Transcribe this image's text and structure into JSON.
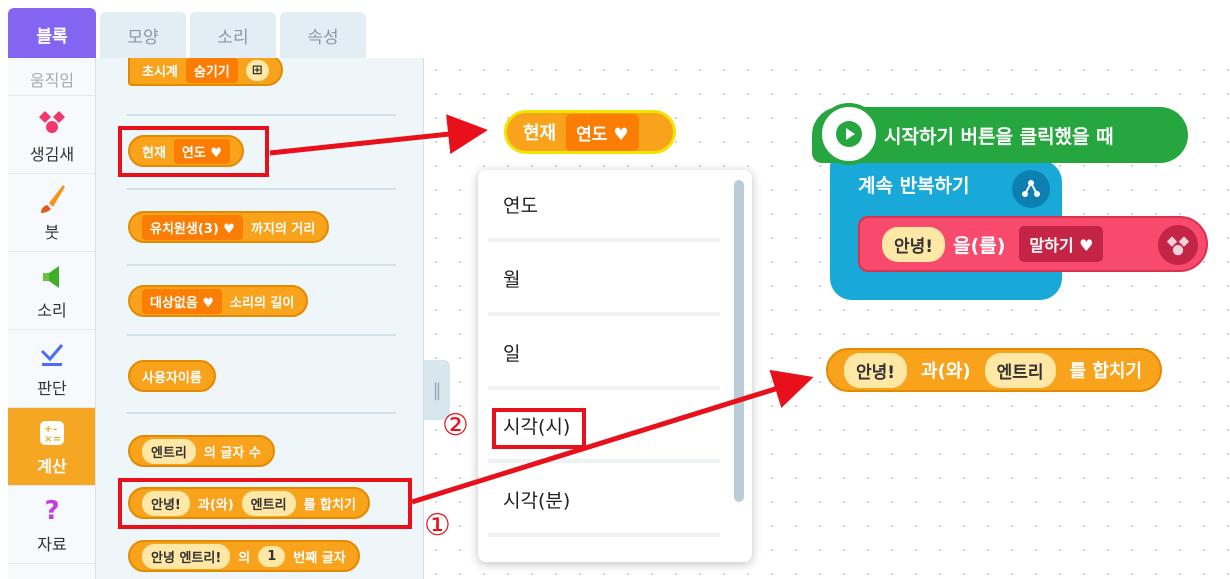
{
  "tabs": [
    "블록",
    "모양",
    "소리",
    "속성"
  ],
  "categories": [
    "움직임",
    "생김새",
    "붓",
    "소리",
    "판단",
    "계산",
    "자료"
  ],
  "palette": {
    "timer": {
      "label": "초시계",
      "dropdown": "숨기기"
    },
    "current": {
      "label": "현재",
      "dropdown": "연도"
    },
    "distance": {
      "dropdown": "유치원생(3)",
      "label": "까지의 거리"
    },
    "sound_len": {
      "dropdown": "대상없음",
      "label": "소리의 길이"
    },
    "username": "사용자이름",
    "length": {
      "value": "엔트리",
      "label": "의 글자 수"
    },
    "join": {
      "a": "안녕!",
      "mid": "과(와)",
      "b": "엔트리",
      "end": "를 합치기"
    },
    "nth": {
      "a": "안녕 엔트리!",
      "mid": "의",
      "n": "1",
      "end": "번째 글자"
    }
  },
  "workspace": {
    "current": {
      "label": "현재",
      "dropdown": "연도"
    },
    "dropdown_items": [
      "연도",
      "월",
      "일",
      "시각(시)",
      "시각(분)"
    ],
    "start": "시작하기 버튼을 클릭했을 때",
    "loop": "계속 반복하기",
    "say": {
      "value": "안녕!",
      "label": "을(를)",
      "dropdown": "말하기"
    },
    "join": {
      "a": "안녕!",
      "mid": "과(와)",
      "b": "엔트리",
      "end": "를 합치기"
    }
  },
  "annotations": {
    "n1": "①",
    "n2": "②"
  }
}
